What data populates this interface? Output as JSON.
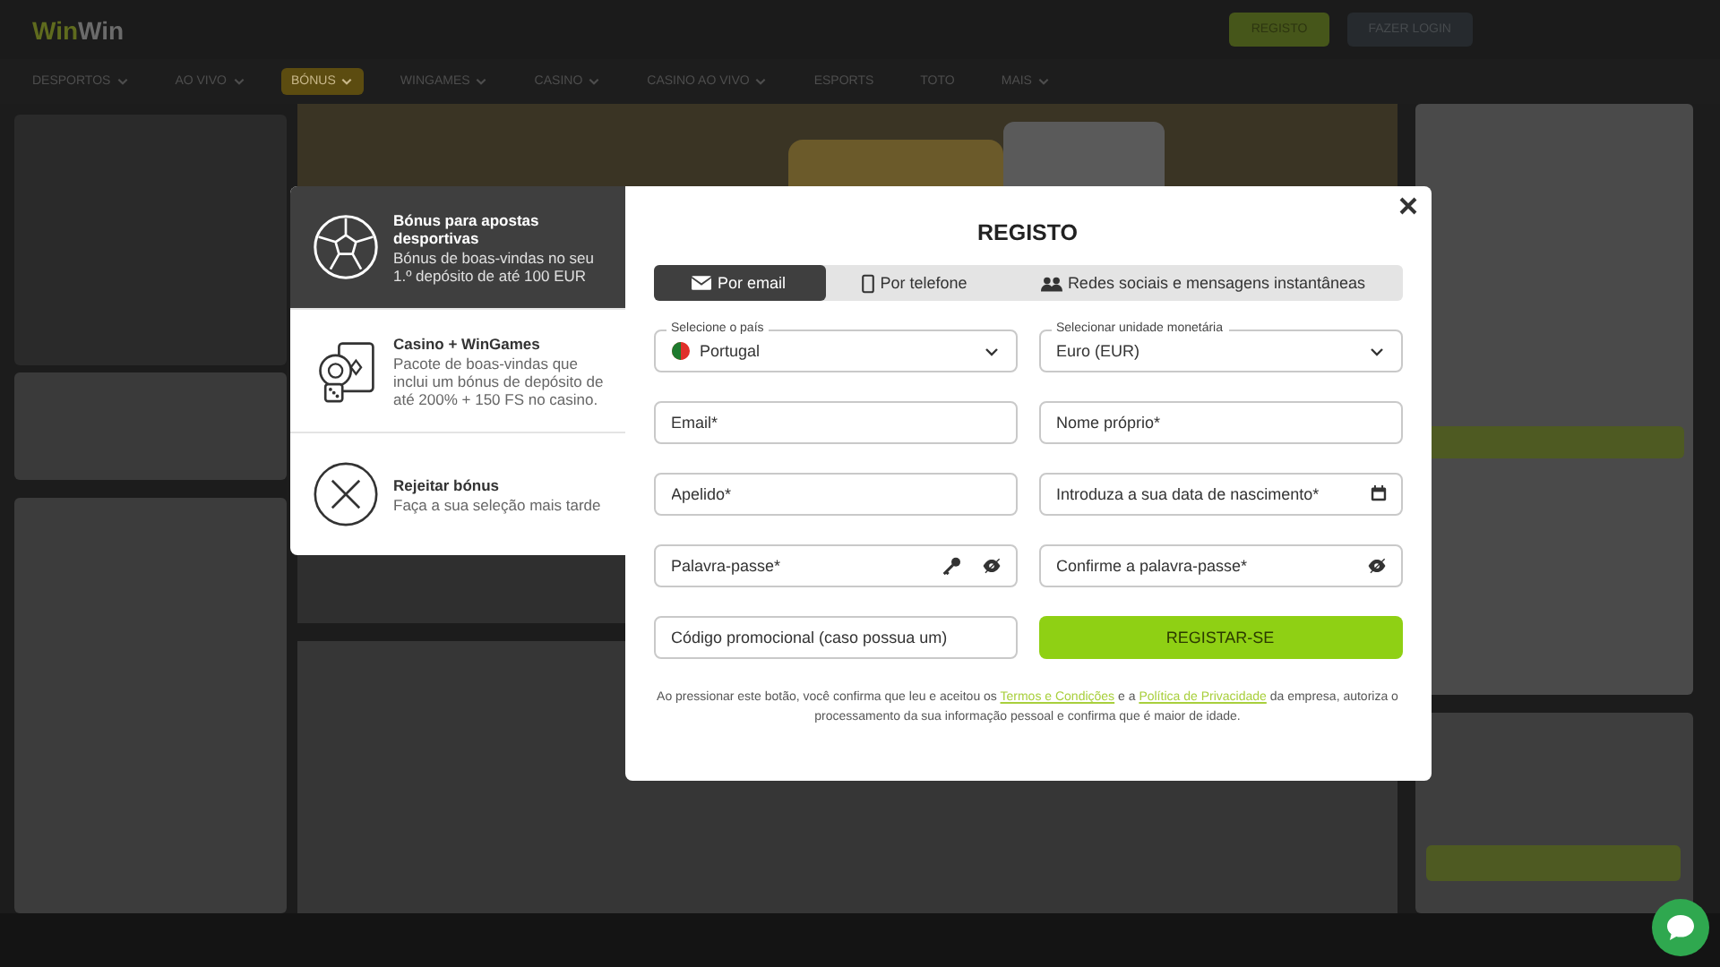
{
  "header": {
    "logo": [
      "Win",
      "Win"
    ],
    "buttons": [
      {
        "label": "REGISTO",
        "kind": "primary"
      },
      {
        "label": "FAZER LOGIN",
        "kind": "secondary"
      }
    ]
  },
  "nav": [
    {
      "label": "DESPORTOS",
      "selected": false,
      "menu": true
    },
    {
      "label": "AO VIVO",
      "selected": false,
      "menu": true
    },
    {
      "label": "BÓNUS",
      "selected": true,
      "menu": true
    },
    {
      "label": "WINGAMES",
      "selected": false,
      "menu": true
    },
    {
      "label": "CASINO",
      "selected": false,
      "menu": true
    },
    {
      "label": "CASINO AO VIVO",
      "selected": false,
      "menu": true
    },
    {
      "label": "ESPORTS",
      "selected": false,
      "menu": false
    },
    {
      "label": "TOTO",
      "selected": false,
      "menu": false
    },
    {
      "label": "MAIS",
      "selected": false,
      "menu": true
    }
  ],
  "bonus_options": [
    {
      "kind": "sport",
      "title": "Bónus para apostas desportivas",
      "text": "Bónus de boas-vindas no seu 1.º depósito de até 100 EUR",
      "selected": true
    },
    {
      "kind": "casino",
      "title": "Casino + WinGames",
      "text": "Pacote de boas-vindas que inclui um bónus de depósito de até 200% + 150 FS no casino.",
      "selected": false
    },
    {
      "kind": "reject",
      "title": "Rejeitar bónus",
      "text": "Faça a sua seleção mais tarde",
      "selected": false
    }
  ],
  "dialog": {
    "title": "REGISTO",
    "tabs": [
      {
        "kind": "email",
        "label": "Por email",
        "selected": true
      },
      {
        "kind": "phone",
        "label": "Por telefone",
        "selected": false
      },
      {
        "kind": "social",
        "label": "Redes sociais e mensagens instantâneas",
        "selected": false
      }
    ],
    "fields": [
      {
        "kind": "select",
        "label": "Selecione o país",
        "value": "Portugal",
        "flag": true
      },
      {
        "kind": "select",
        "label": "Selecionar unidade monetária",
        "value": "Euro (EUR)",
        "flag": false
      },
      {
        "kind": "text",
        "placeholder": "Email*"
      },
      {
        "kind": "text",
        "placeholder": "Nome próprio*"
      },
      {
        "kind": "text",
        "placeholder": "Apelido*"
      },
      {
        "kind": "date",
        "placeholder": "Introduza a sua data de nascimento*"
      },
      {
        "kind": "password",
        "placeholder": "Palavra-passe*",
        "generator": true
      },
      {
        "kind": "password",
        "placeholder": "Confirme a palavra-passe*",
        "generator": false
      },
      {
        "kind": "text",
        "placeholder": "Código promocional (caso possua um)"
      }
    ],
    "submit": "REGISTAR-SE",
    "disclaimer": [
      {
        "kind": "text",
        "text": "Ao pressionar este botão, você confirma que leu e aceitou os "
      },
      {
        "kind": "link",
        "text": "Termos e Condições"
      },
      {
        "kind": "text",
        "text": " e a "
      },
      {
        "kind": "link",
        "text": "Política de Privacidade"
      },
      {
        "kind": "text",
        "text": " da empresa, autoriza o processamento da sua informação pessoal e confirma que é maior de idade."
      }
    ]
  }
}
